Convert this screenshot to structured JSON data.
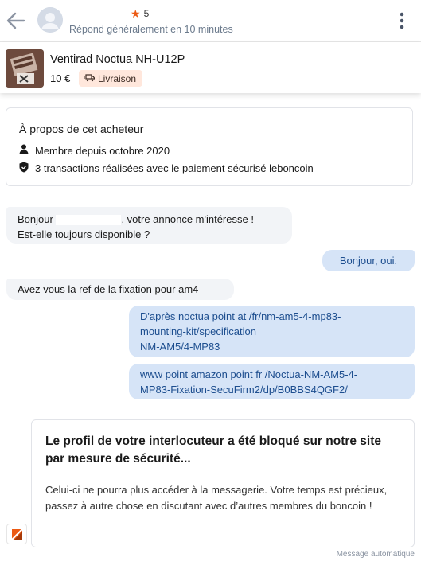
{
  "header": {
    "rating": "5",
    "reply_time": "Répond généralement en 10 minutes"
  },
  "product": {
    "title": "Ventirad Noctua NH-U12P",
    "price": "10 €",
    "delivery_label": "Livraison"
  },
  "about": {
    "title": "À propos de cet acheteur",
    "member_since": "Membre depuis octobre 2020",
    "transactions": "3 transactions réalisées avec le paiement sécurisé leboncoin"
  },
  "messages": {
    "m1_before": "Bonjour",
    "m1_after": ", votre annonce m'intéresse !",
    "m1_line2": "Est-elle toujours disponible ?",
    "m2": "Bonjour, oui.",
    "m3": "Avez vous la ref de la fixation pour am4",
    "m4_line1": "D'après noctua point at /fr/nm-am5-4-mp83-",
    "m4_line2": "mounting-kit/specification",
    "m4_line3": "NM-AM5/4-MP83",
    "m5_line1": "www point amazon point fr /Noctua-NM-AM5-4-",
    "m5_line2": "MP83-Fixation-SecuFirm2/dp/B0BBS4QGF2/"
  },
  "blocked": {
    "title": "Le profil de votre interlocuteur a été bloqué sur notre site par mesure de sécurité...",
    "body": "Celui-ci ne pourra plus accéder à la messagerie. Votre temps est précieux, passez à autre chose en discutant avec d’autres membres du boncoin !"
  },
  "auto_label": "Message automatique",
  "colors": {
    "accent": "#ec5a13",
    "out_bubble": "#d6e4f7",
    "in_bubble": "#f2f4f7",
    "delivery_badge": "#ffe7dc"
  },
  "icons": [
    "back-arrow-icon",
    "avatar-icon",
    "star-icon",
    "kebab-menu-icon",
    "truck-icon",
    "person-icon",
    "shield-icon",
    "leboncoin-logo-icon"
  ]
}
